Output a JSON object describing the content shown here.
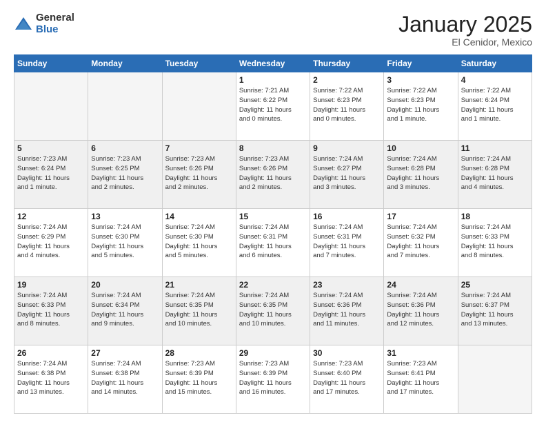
{
  "logo": {
    "general": "General",
    "blue": "Blue"
  },
  "header": {
    "title": "January 2025",
    "location": "El Cenidor, Mexico"
  },
  "weekdays": [
    "Sunday",
    "Monday",
    "Tuesday",
    "Wednesday",
    "Thursday",
    "Friday",
    "Saturday"
  ],
  "weeks": [
    [
      {
        "day": "",
        "info": ""
      },
      {
        "day": "",
        "info": ""
      },
      {
        "day": "",
        "info": ""
      },
      {
        "day": "1",
        "info": "Sunrise: 7:21 AM\nSunset: 6:22 PM\nDaylight: 11 hours\nand 0 minutes."
      },
      {
        "day": "2",
        "info": "Sunrise: 7:22 AM\nSunset: 6:23 PM\nDaylight: 11 hours\nand 0 minutes."
      },
      {
        "day": "3",
        "info": "Sunrise: 7:22 AM\nSunset: 6:23 PM\nDaylight: 11 hours\nand 1 minute."
      },
      {
        "day": "4",
        "info": "Sunrise: 7:22 AM\nSunset: 6:24 PM\nDaylight: 11 hours\nand 1 minute."
      }
    ],
    [
      {
        "day": "5",
        "info": "Sunrise: 7:23 AM\nSunset: 6:24 PM\nDaylight: 11 hours\nand 1 minute."
      },
      {
        "day": "6",
        "info": "Sunrise: 7:23 AM\nSunset: 6:25 PM\nDaylight: 11 hours\nand 2 minutes."
      },
      {
        "day": "7",
        "info": "Sunrise: 7:23 AM\nSunset: 6:26 PM\nDaylight: 11 hours\nand 2 minutes."
      },
      {
        "day": "8",
        "info": "Sunrise: 7:23 AM\nSunset: 6:26 PM\nDaylight: 11 hours\nand 2 minutes."
      },
      {
        "day": "9",
        "info": "Sunrise: 7:24 AM\nSunset: 6:27 PM\nDaylight: 11 hours\nand 3 minutes."
      },
      {
        "day": "10",
        "info": "Sunrise: 7:24 AM\nSunset: 6:28 PM\nDaylight: 11 hours\nand 3 minutes."
      },
      {
        "day": "11",
        "info": "Sunrise: 7:24 AM\nSunset: 6:28 PM\nDaylight: 11 hours\nand 4 minutes."
      }
    ],
    [
      {
        "day": "12",
        "info": "Sunrise: 7:24 AM\nSunset: 6:29 PM\nDaylight: 11 hours\nand 4 minutes."
      },
      {
        "day": "13",
        "info": "Sunrise: 7:24 AM\nSunset: 6:30 PM\nDaylight: 11 hours\nand 5 minutes."
      },
      {
        "day": "14",
        "info": "Sunrise: 7:24 AM\nSunset: 6:30 PM\nDaylight: 11 hours\nand 5 minutes."
      },
      {
        "day": "15",
        "info": "Sunrise: 7:24 AM\nSunset: 6:31 PM\nDaylight: 11 hours\nand 6 minutes."
      },
      {
        "day": "16",
        "info": "Sunrise: 7:24 AM\nSunset: 6:31 PM\nDaylight: 11 hours\nand 7 minutes."
      },
      {
        "day": "17",
        "info": "Sunrise: 7:24 AM\nSunset: 6:32 PM\nDaylight: 11 hours\nand 7 minutes."
      },
      {
        "day": "18",
        "info": "Sunrise: 7:24 AM\nSunset: 6:33 PM\nDaylight: 11 hours\nand 8 minutes."
      }
    ],
    [
      {
        "day": "19",
        "info": "Sunrise: 7:24 AM\nSunset: 6:33 PM\nDaylight: 11 hours\nand 8 minutes."
      },
      {
        "day": "20",
        "info": "Sunrise: 7:24 AM\nSunset: 6:34 PM\nDaylight: 11 hours\nand 9 minutes."
      },
      {
        "day": "21",
        "info": "Sunrise: 7:24 AM\nSunset: 6:35 PM\nDaylight: 11 hours\nand 10 minutes."
      },
      {
        "day": "22",
        "info": "Sunrise: 7:24 AM\nSunset: 6:35 PM\nDaylight: 11 hours\nand 10 minutes."
      },
      {
        "day": "23",
        "info": "Sunrise: 7:24 AM\nSunset: 6:36 PM\nDaylight: 11 hours\nand 11 minutes."
      },
      {
        "day": "24",
        "info": "Sunrise: 7:24 AM\nSunset: 6:36 PM\nDaylight: 11 hours\nand 12 minutes."
      },
      {
        "day": "25",
        "info": "Sunrise: 7:24 AM\nSunset: 6:37 PM\nDaylight: 11 hours\nand 13 minutes."
      }
    ],
    [
      {
        "day": "26",
        "info": "Sunrise: 7:24 AM\nSunset: 6:38 PM\nDaylight: 11 hours\nand 13 minutes."
      },
      {
        "day": "27",
        "info": "Sunrise: 7:24 AM\nSunset: 6:38 PM\nDaylight: 11 hours\nand 14 minutes."
      },
      {
        "day": "28",
        "info": "Sunrise: 7:23 AM\nSunset: 6:39 PM\nDaylight: 11 hours\nand 15 minutes."
      },
      {
        "day": "29",
        "info": "Sunrise: 7:23 AM\nSunset: 6:39 PM\nDaylight: 11 hours\nand 16 minutes."
      },
      {
        "day": "30",
        "info": "Sunrise: 7:23 AM\nSunset: 6:40 PM\nDaylight: 11 hours\nand 17 minutes."
      },
      {
        "day": "31",
        "info": "Sunrise: 7:23 AM\nSunset: 6:41 PM\nDaylight: 11 hours\nand 17 minutes."
      },
      {
        "day": "",
        "info": ""
      }
    ]
  ]
}
